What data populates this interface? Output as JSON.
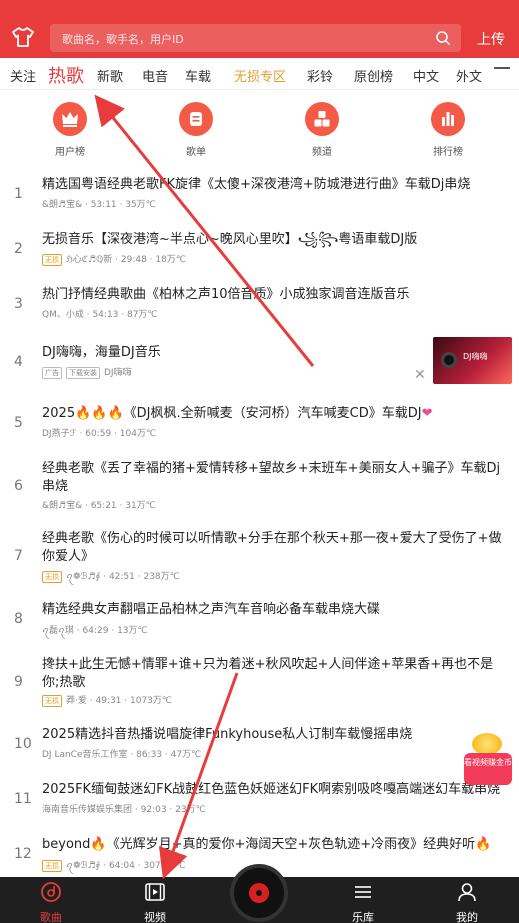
{
  "header": {
    "search_placeholder": "歌曲名，歌手名，用户ID",
    "upload_label": "上传",
    "colors": {
      "brand": "#e83c3c"
    }
  },
  "tabs": [
    "关注",
    "热歌",
    "新歌",
    "电音",
    "车载",
    "无损专区",
    "彩铃",
    "原创榜",
    "中文",
    "外文"
  ],
  "active_tab": "热歌",
  "categories": [
    {
      "label": "用户榜",
      "icon": "crown-icon"
    },
    {
      "label": "歌单",
      "icon": "list-icon"
    },
    {
      "label": "频道",
      "icon": "blocks-icon"
    },
    {
      "label": "排行榜",
      "icon": "bar-chart-icon"
    }
  ],
  "songs": [
    {
      "num": "1",
      "title": "精选国粤语经典老歌FK旋律《太傻+深夜港湾+防城港进行曲》车载Dj串烧",
      "artist": "&朗♬宝&",
      "duration": "53:11",
      "plays": "35万℃"
    },
    {
      "num": "2",
      "title": "无损音乐【深夜港湾~半点心~晚风心里吹】꧁꧂粤语車载DJ版",
      "tag": "无损",
      "artist": "ℌ心ℭ♬ℚ新",
      "duration": "29:48",
      "plays": "18万℃"
    },
    {
      "num": "3",
      "title": "热门抒情经典歌曲《柏林之声10倍音质》小成独家调音连版音乐",
      "artist": "QM、小成",
      "duration": "54:13",
      "plays": "87万℃"
    },
    {
      "num": "4",
      "title": "DJ嗨嗨，海量DJ音乐",
      "ad_tag": "广告",
      "dl_tag": "下载安装",
      "artist": "DJ嗨嗨",
      "thumb_text": "DJ嗨嗨"
    },
    {
      "num": "5",
      "title_prefix": "2025",
      "title": "《DJ枫枫.全新喊麦（安河桥）汽车喊麦CD》车载DJ",
      "artist": "DJ燕子ℱ",
      "duration": "60:59",
      "plays": "104万℃"
    },
    {
      "num": "6",
      "title": "经典老歌《丢了幸福的猪+爱情转移+望故乡+末班车+美丽女人+骗子》车载Dj串烧",
      "artist": "&朗♬宝&",
      "duration": "65:21",
      "plays": "31万℃"
    },
    {
      "num": "7",
      "title": "经典老歌《伤心的时候可以听情歌+分手在那个秋天+那一夜+爱大了受伤了+做你爱人》",
      "tag": "无损",
      "artist": "ꪖ❁ℬ♬∮",
      "duration": "42:51",
      "plays": "238万℃"
    },
    {
      "num": "8",
      "title": "精选经典女声翻唱正品柏林之声汽车音响必备车载串烧大碟",
      "artist": "ꪖ磊ꪖ琪",
      "duration": "64:29",
      "plays": "13万℃"
    },
    {
      "num": "9",
      "title": "搀扶+此生无憾+情罪+谁+只为着迷+秋风吹起+人间伴途+苹果香+再也不是你;热歌",
      "tag": "无损",
      "artist": "莽·爱",
      "duration": "49:31",
      "plays": "1073万℃"
    },
    {
      "num": "10",
      "title": "2025精选抖音热播说唱旋律Funkyhouse私人订制车载慢摇串烧",
      "artist": "DJ LanCe音乐工作室",
      "duration": "86:33",
      "plays": "47万℃"
    },
    {
      "num": "11",
      "title": "2025FK缅甸鼓迷幻FK战鼓红色蓝色妖姬迷幻FK啊索别吸咚嘎高端迷幻车载串烧",
      "artist": "海南音乐传媒娱乐集团",
      "duration": "92:03",
      "plays": "23万℃"
    },
    {
      "num": "12",
      "title_prefix": "beyond",
      "title": "《光辉岁月+真的爱你+海阔天空+灰色轨迹+冷雨夜》经典好听",
      "tag": "无损",
      "artist": "ꪖ❁ℬ♬∮",
      "duration": "64:04",
      "plays": "3078万℃"
    }
  ],
  "promo": {
    "text": "看视频赚金币"
  },
  "bottom_nav": [
    {
      "label": "歌曲",
      "icon": "music-disc-icon",
      "active": true
    },
    {
      "label": "视频",
      "icon": "video-icon",
      "active": false
    },
    {
      "label": "乐库",
      "icon": "library-icon",
      "active": false
    },
    {
      "label": "我的",
      "icon": "user-icon",
      "active": false
    }
  ]
}
